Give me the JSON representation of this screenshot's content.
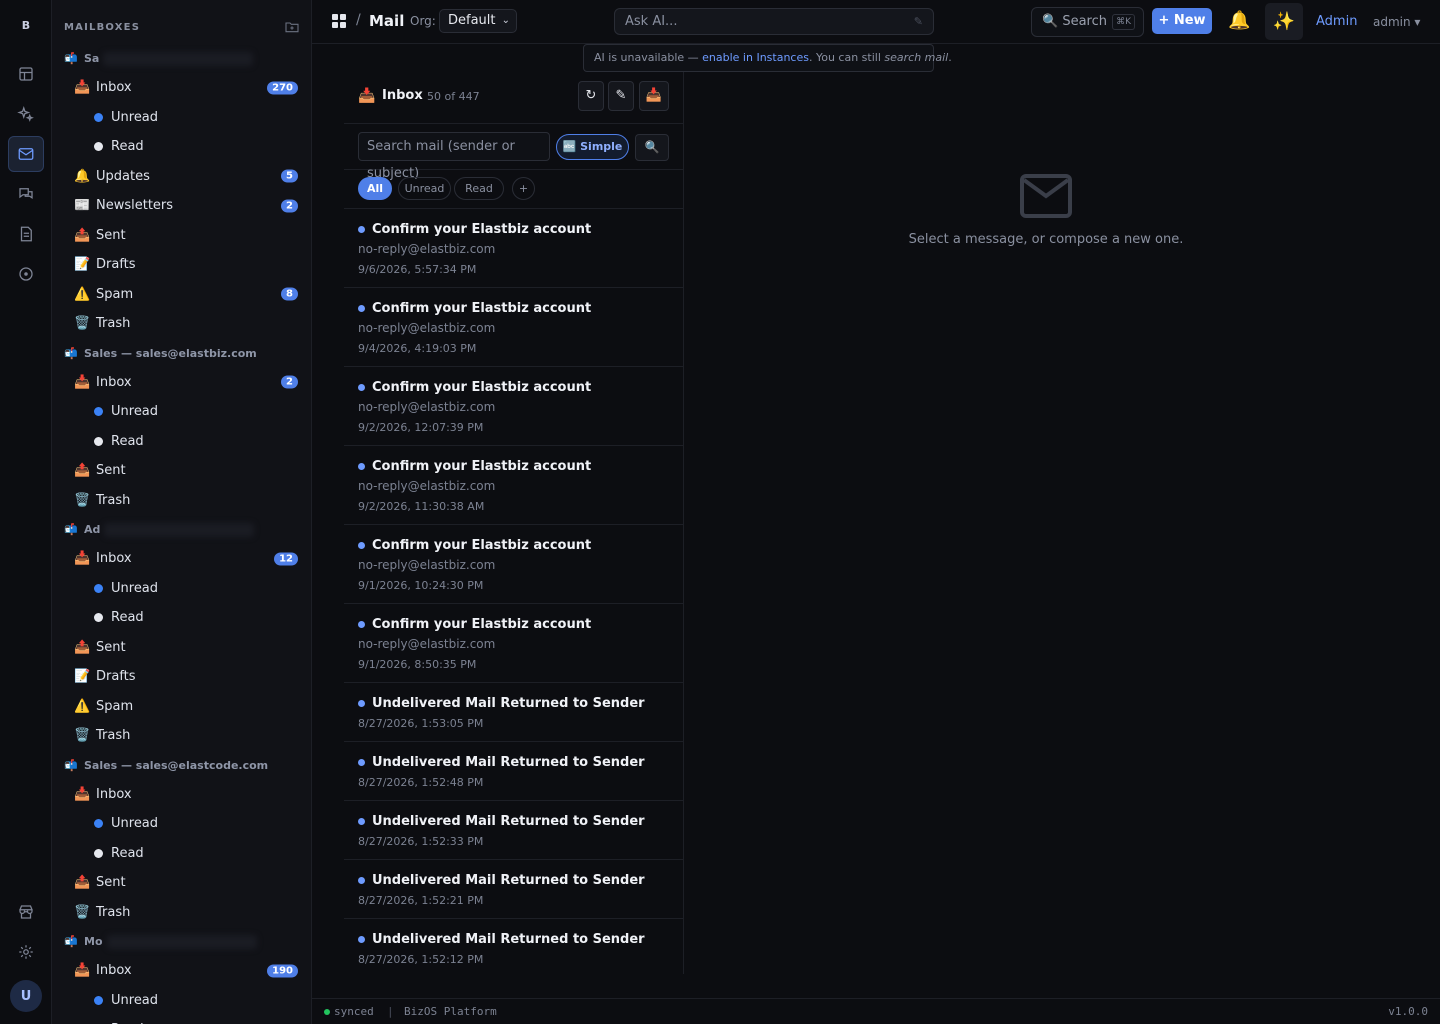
{
  "rail": {
    "logo": "B",
    "avatar": "U",
    "items": [
      "table-icon",
      "sparkle-icon",
      "mail-icon",
      "chat-icon",
      "document-icon",
      "compass-icon",
      "store-icon",
      "gear-icon"
    ]
  },
  "sidebar": {
    "title": "MAILBOXES",
    "accounts": [
      {
        "label": "Sa",
        "redacted": true,
        "folders": [
          {
            "icon": "📥",
            "label": "Inbox",
            "badge": "270",
            "subs": [
              {
                "label": "Unread",
                "dot": "blue"
              },
              {
                "label": "Read",
                "dot": "white"
              }
            ]
          },
          {
            "icon": "🔔",
            "label": "Updates",
            "badge": "5"
          },
          {
            "icon": "📰",
            "label": "Newsletters",
            "badge": "2"
          },
          {
            "icon": "📤",
            "label": "Sent"
          },
          {
            "icon": "📝",
            "label": "Drafts"
          },
          {
            "icon": "⚠️",
            "label": "Spam",
            "badge": "8"
          },
          {
            "icon": "🗑️",
            "label": "Trash"
          }
        ]
      },
      {
        "label": "Sales — sales@elastbiz.com",
        "folders": [
          {
            "icon": "📥",
            "label": "Inbox",
            "badge": "2",
            "subs": [
              {
                "label": "Unread",
                "dot": "blue"
              },
              {
                "label": "Read",
                "dot": "white"
              }
            ]
          },
          {
            "icon": "📤",
            "label": "Sent"
          },
          {
            "icon": "🗑️",
            "label": "Trash"
          }
        ]
      },
      {
        "label": "Ad",
        "redacted": true,
        "folders": [
          {
            "icon": "📥",
            "label": "Inbox",
            "badge": "12",
            "subs": [
              {
                "label": "Unread",
                "dot": "blue"
              },
              {
                "label": "Read",
                "dot": "white"
              }
            ]
          },
          {
            "icon": "📤",
            "label": "Sent"
          },
          {
            "icon": "📝",
            "label": "Drafts"
          },
          {
            "icon": "⚠️",
            "label": "Spam"
          },
          {
            "icon": "🗑️",
            "label": "Trash"
          }
        ]
      },
      {
        "label": "Sales — sales@elastcode.com",
        "folders": [
          {
            "icon": "📥",
            "label": "Inbox",
            "subs": [
              {
                "label": "Unread",
                "dot": "blue"
              },
              {
                "label": "Read",
                "dot": "white"
              }
            ]
          },
          {
            "icon": "📤",
            "label": "Sent"
          },
          {
            "icon": "🗑️",
            "label": "Trash"
          }
        ]
      },
      {
        "label": "Mo",
        "redacted": true,
        "folders": [
          {
            "icon": "📥",
            "label": "Inbox",
            "badge": "190",
            "subs": [
              {
                "label": "Unread",
                "dot": "blue"
              },
              {
                "label": "Read",
                "dot": "white"
              }
            ]
          }
        ]
      }
    ]
  },
  "topbar": {
    "separator": "/",
    "app_title": "Mail",
    "org_label": "Org:",
    "org_value": "Default",
    "ask_placeholder": "Ask AI...",
    "search_label": "Search",
    "search_shortcut": "⌘K",
    "new_label": "+ New",
    "bell_icon": "🔔",
    "spark_icon": "✨",
    "admin_link": "Admin",
    "user_menu": "admin ▾"
  },
  "ai_banner": {
    "prefix": "AI is unavailable — ",
    "link": "enable in Instances",
    "middle": ". You can still ",
    "em": "search mail",
    "suffix": "."
  },
  "list": {
    "icon": "📥",
    "title": "Inbox",
    "count": "50 of 447",
    "refresh": "↻",
    "compose": "✎",
    "inbox_btn": "📥",
    "search_placeholder": "Search mail (sender or subject)",
    "mode_label": "🔤 Simple",
    "search_btn": "🔍",
    "filters": [
      "All",
      "Unread",
      "Read",
      "+"
    ],
    "active_filter": "All",
    "messages": [
      {
        "subject": "Confirm your Elastbiz account",
        "from": "no-reply@elastbiz.com",
        "date": "9/6/2026, 5:57:34 PM"
      },
      {
        "subject": "Confirm your Elastbiz account",
        "from": "no-reply@elastbiz.com",
        "date": "9/4/2026, 4:19:03 PM"
      },
      {
        "subject": "Confirm your Elastbiz account",
        "from": "no-reply@elastbiz.com",
        "date": "9/2/2026, 12:07:39 PM"
      },
      {
        "subject": "Confirm your Elastbiz account",
        "from": "no-reply@elastbiz.com",
        "date": "9/2/2026, 11:30:38 AM"
      },
      {
        "subject": "Confirm your Elastbiz account",
        "from": "no-reply@elastbiz.com",
        "date": "9/1/2026, 10:24:30 PM"
      },
      {
        "subject": "Confirm your Elastbiz account",
        "from": "no-reply@elastbiz.com",
        "date": "9/1/2026, 8:50:35 PM"
      },
      {
        "subject": "Undelivered Mail Returned to Sender",
        "from": "",
        "date": "8/27/2026, 1:53:05 PM"
      },
      {
        "subject": "Undelivered Mail Returned to Sender",
        "from": "",
        "date": "8/27/2026, 1:52:48 PM"
      },
      {
        "subject": "Undelivered Mail Returned to Sender",
        "from": "",
        "date": "8/27/2026, 1:52:33 PM"
      },
      {
        "subject": "Undelivered Mail Returned to Sender",
        "from": "",
        "date": "8/27/2026, 1:52:21 PM"
      },
      {
        "subject": "Undelivered Mail Returned to Sender",
        "from": "",
        "date": "8/27/2026, 1:52:12 PM"
      }
    ]
  },
  "reading": {
    "empty_text": "Select a message, or compose a new one."
  },
  "status": {
    "state": "synced",
    "separator": "|",
    "platform": "BizOS Platform",
    "version": "v1.0.0"
  },
  "colors": {
    "accent": "#4f7fe8",
    "link": "#6e9bff",
    "unread_dot": "#3b82f6",
    "sync_ok": "#22c55e"
  }
}
